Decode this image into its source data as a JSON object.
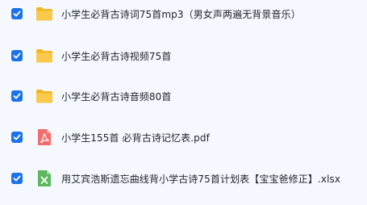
{
  "files": [
    {
      "name": "小学生必背古诗词75首mp3（男女声两遍无背景音乐）",
      "icon": "folder-icon",
      "checked": true
    },
    {
      "name": "小学生必背古诗视频75首",
      "icon": "folder-icon",
      "checked": true
    },
    {
      "name": "小学生必背古诗音频80首",
      "icon": "folder-icon",
      "checked": true
    },
    {
      "name": "小学生155首 必背古诗记忆表.pdf",
      "icon": "pdf-icon",
      "checked": true
    },
    {
      "name": "用艾宾浩斯遗忘曲线背小学古诗75首计划表【宝宝爸修正】.xlsx",
      "icon": "excel-icon",
      "checked": true
    }
  ],
  "colors": {
    "checkbox": "#1a73e8",
    "folder": "#f8c53a",
    "pdf": "#f26d6d",
    "excel": "#5cb85c"
  }
}
